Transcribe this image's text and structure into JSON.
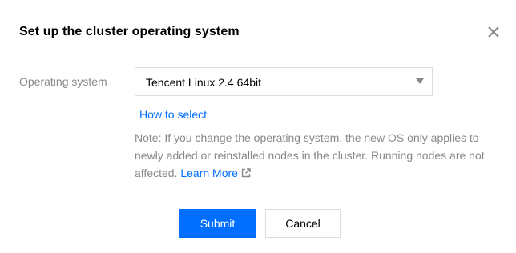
{
  "dialog": {
    "title": "Set up the cluster operating system",
    "close_icon": "close-icon"
  },
  "form": {
    "os_label": "Operating system",
    "os_value": "Tencent Linux 2.4 64bit",
    "caret_icon": "caret-down-icon"
  },
  "help": {
    "how_to_select": "How to select"
  },
  "note": {
    "text": "Note: If you change the operating system, the new OS only applies to newly added or reinstalled nodes in the cluster. Running nodes are not affected.",
    "learn_more": "Learn More",
    "external_icon": "external-link-icon"
  },
  "footer": {
    "submit_label": "Submit",
    "cancel_label": "Cancel"
  },
  "colors": {
    "accent": "#006eff",
    "muted_text": "#888888",
    "border": "#dddddd"
  }
}
